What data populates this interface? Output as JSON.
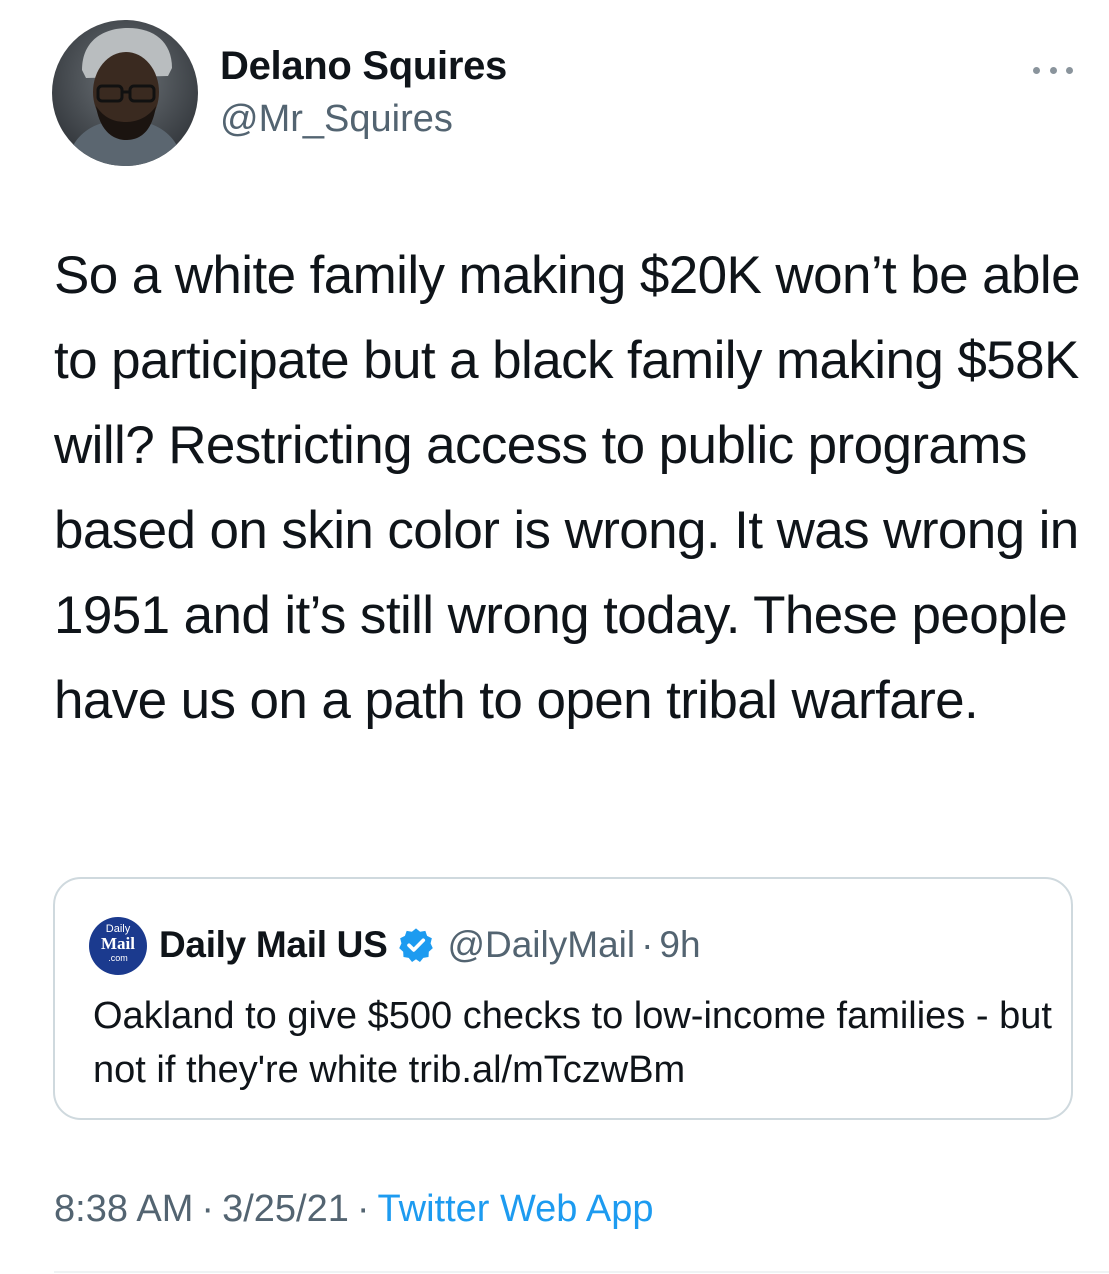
{
  "tweet": {
    "author": {
      "display_name": "Delano Squires",
      "handle": "@Mr_Squires",
      "avatar_icon": "profile-photo-avatar"
    },
    "more_icon": "more-dots-icon",
    "text": "So a white family making $20K won’t be able to participate but a black family making $58K will? Restricting access to public programs based on skin color is wrong. It was wrong in 1951 and it’s still wrong today. These people have us on a path to open tribal warfare.",
    "quoted": {
      "logo": {
        "line1": "Daily",
        "line2": "Mail",
        "line3": ".com"
      },
      "display_name": "Daily Mail US",
      "verified_icon": "verified-badge-icon",
      "handle": "@DailyMail",
      "separator": "·",
      "time_ago": "9h",
      "text": "Oakland to give $500 checks to low-income families - but not if they're white trib.al/mTczwBm"
    },
    "meta": {
      "time": "8:38 AM",
      "separator": "·",
      "date": "3/25/21",
      "source": "Twitter Web App"
    }
  },
  "colors": {
    "text_primary": "#0f1419",
    "text_secondary": "#536471",
    "link": "#1d9bf0",
    "border": "#cfd9de",
    "dailymail_blue": "#1b3a8e"
  }
}
